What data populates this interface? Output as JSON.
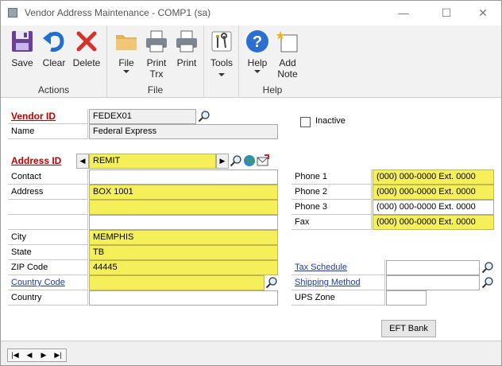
{
  "window": {
    "title": "Vendor Address Maintenance  -  COMP1 (sa)",
    "minimize_glyph": "—",
    "maximize_glyph": "☐",
    "close_glyph": "✕"
  },
  "ribbon": {
    "groups": {
      "actions": "Actions",
      "file": "File",
      "tools": "",
      "help": "Help"
    },
    "buttons": {
      "save": "Save",
      "clear": "Clear",
      "delete": "Delete",
      "file": "File",
      "print_trx_1": "Print",
      "print_trx_2": "Trx",
      "print": "Print",
      "tools": "Tools",
      "help": "Help",
      "add_note_1": "Add",
      "add_note_2": "Note"
    }
  },
  "form": {
    "vendor_id_label": "Vendor ID",
    "vendor_id": "FEDEX01",
    "name_label": "Name",
    "name": "Federal Express",
    "inactive_label": "Inactive",
    "address_id_label": "Address ID",
    "address_id": "REMIT",
    "contact_label": "Contact",
    "contact": "",
    "address_label": "Address",
    "address_1": "BOX 1001",
    "address_2": "",
    "address_3": "",
    "city_label": "City",
    "city": "MEMPHIS",
    "state_label": "State",
    "state": "TB",
    "zip_label": "ZIP Code",
    "zip": "44445",
    "country_code_label": "Country Code",
    "country_code": "",
    "country_label": "Country",
    "country": "",
    "phone1_label": "Phone 1",
    "phone1": "(000) 000-0000  Ext. 0000",
    "phone2_label": "Phone 2",
    "phone2": "(000) 000-0000  Ext. 0000",
    "phone3_label": "Phone 3",
    "phone3": "(000) 000-0000  Ext. 0000",
    "fax_label": "Fax",
    "fax": "(000) 000-0000  Ext. 0000",
    "tax_schedule_label": "Tax Schedule",
    "tax_schedule": "",
    "shipping_method_label": "Shipping Method",
    "shipping_method": "",
    "ups_zone_label": "UPS Zone",
    "ups_zone": "",
    "eft_bank_label": "EFT Bank"
  },
  "colors": {
    "required_field": "#f5ef59",
    "required_label": "#c00000",
    "link_label": "#1f3b9e"
  }
}
